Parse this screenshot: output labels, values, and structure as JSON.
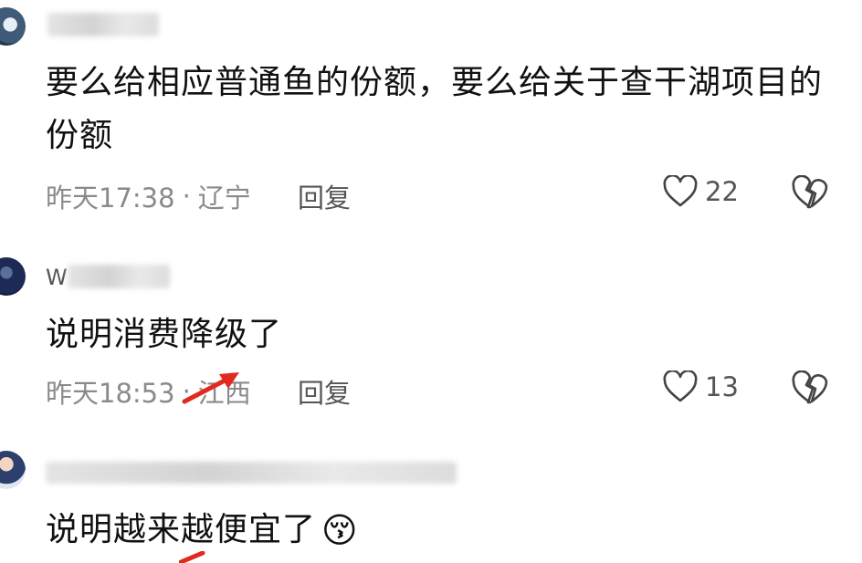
{
  "comments": [
    {
      "text": "要么给相应普通鱼的份额，要么给关于查干湖项目的份额",
      "time": "昨天17:38",
      "separator": "·",
      "location": "辽宁",
      "reply_label": "回复",
      "likes": "22"
    },
    {
      "username_initial": "W",
      "text": "说明消费降级了",
      "time": "昨天18:53",
      "separator": "·",
      "location": "江西",
      "reply_label": "回复",
      "likes": "13"
    },
    {
      "text": "说明越来越便宜了",
      "emoji": "😚"
    }
  ],
  "icons": {
    "like": "heart-outline-icon",
    "dislike": "broken-heart-icon",
    "annotation": "red-arrow-icon"
  },
  "colors": {
    "text": "#111111",
    "meta": "#8a8a8a",
    "arrow": "#e02a1f"
  }
}
